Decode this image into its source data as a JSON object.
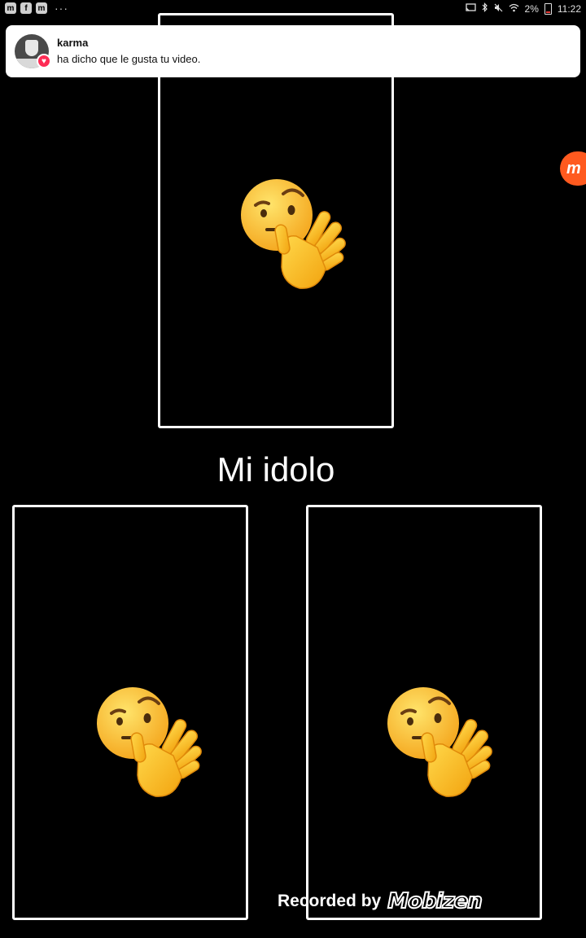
{
  "status_bar": {
    "left_icons": [
      "mobizen-icon",
      "flipboard-icon",
      "mobizen-icon"
    ],
    "overflow": "···",
    "battery": "2%",
    "time": "11:22"
  },
  "notification": {
    "username": "karma",
    "message": "ha dicho que le gusta tu video."
  },
  "video": {
    "caption": "Mi idolo",
    "emoji": "face-with-raised-eyebrow-waving-hand"
  },
  "watermark": {
    "label": "Recorded by",
    "brand": "Mobizen"
  },
  "colors": {
    "background": "#000000",
    "frame": "#ffffff",
    "like_badge": "#fe2c55",
    "mobizen_accent": "#ff5a1f"
  }
}
